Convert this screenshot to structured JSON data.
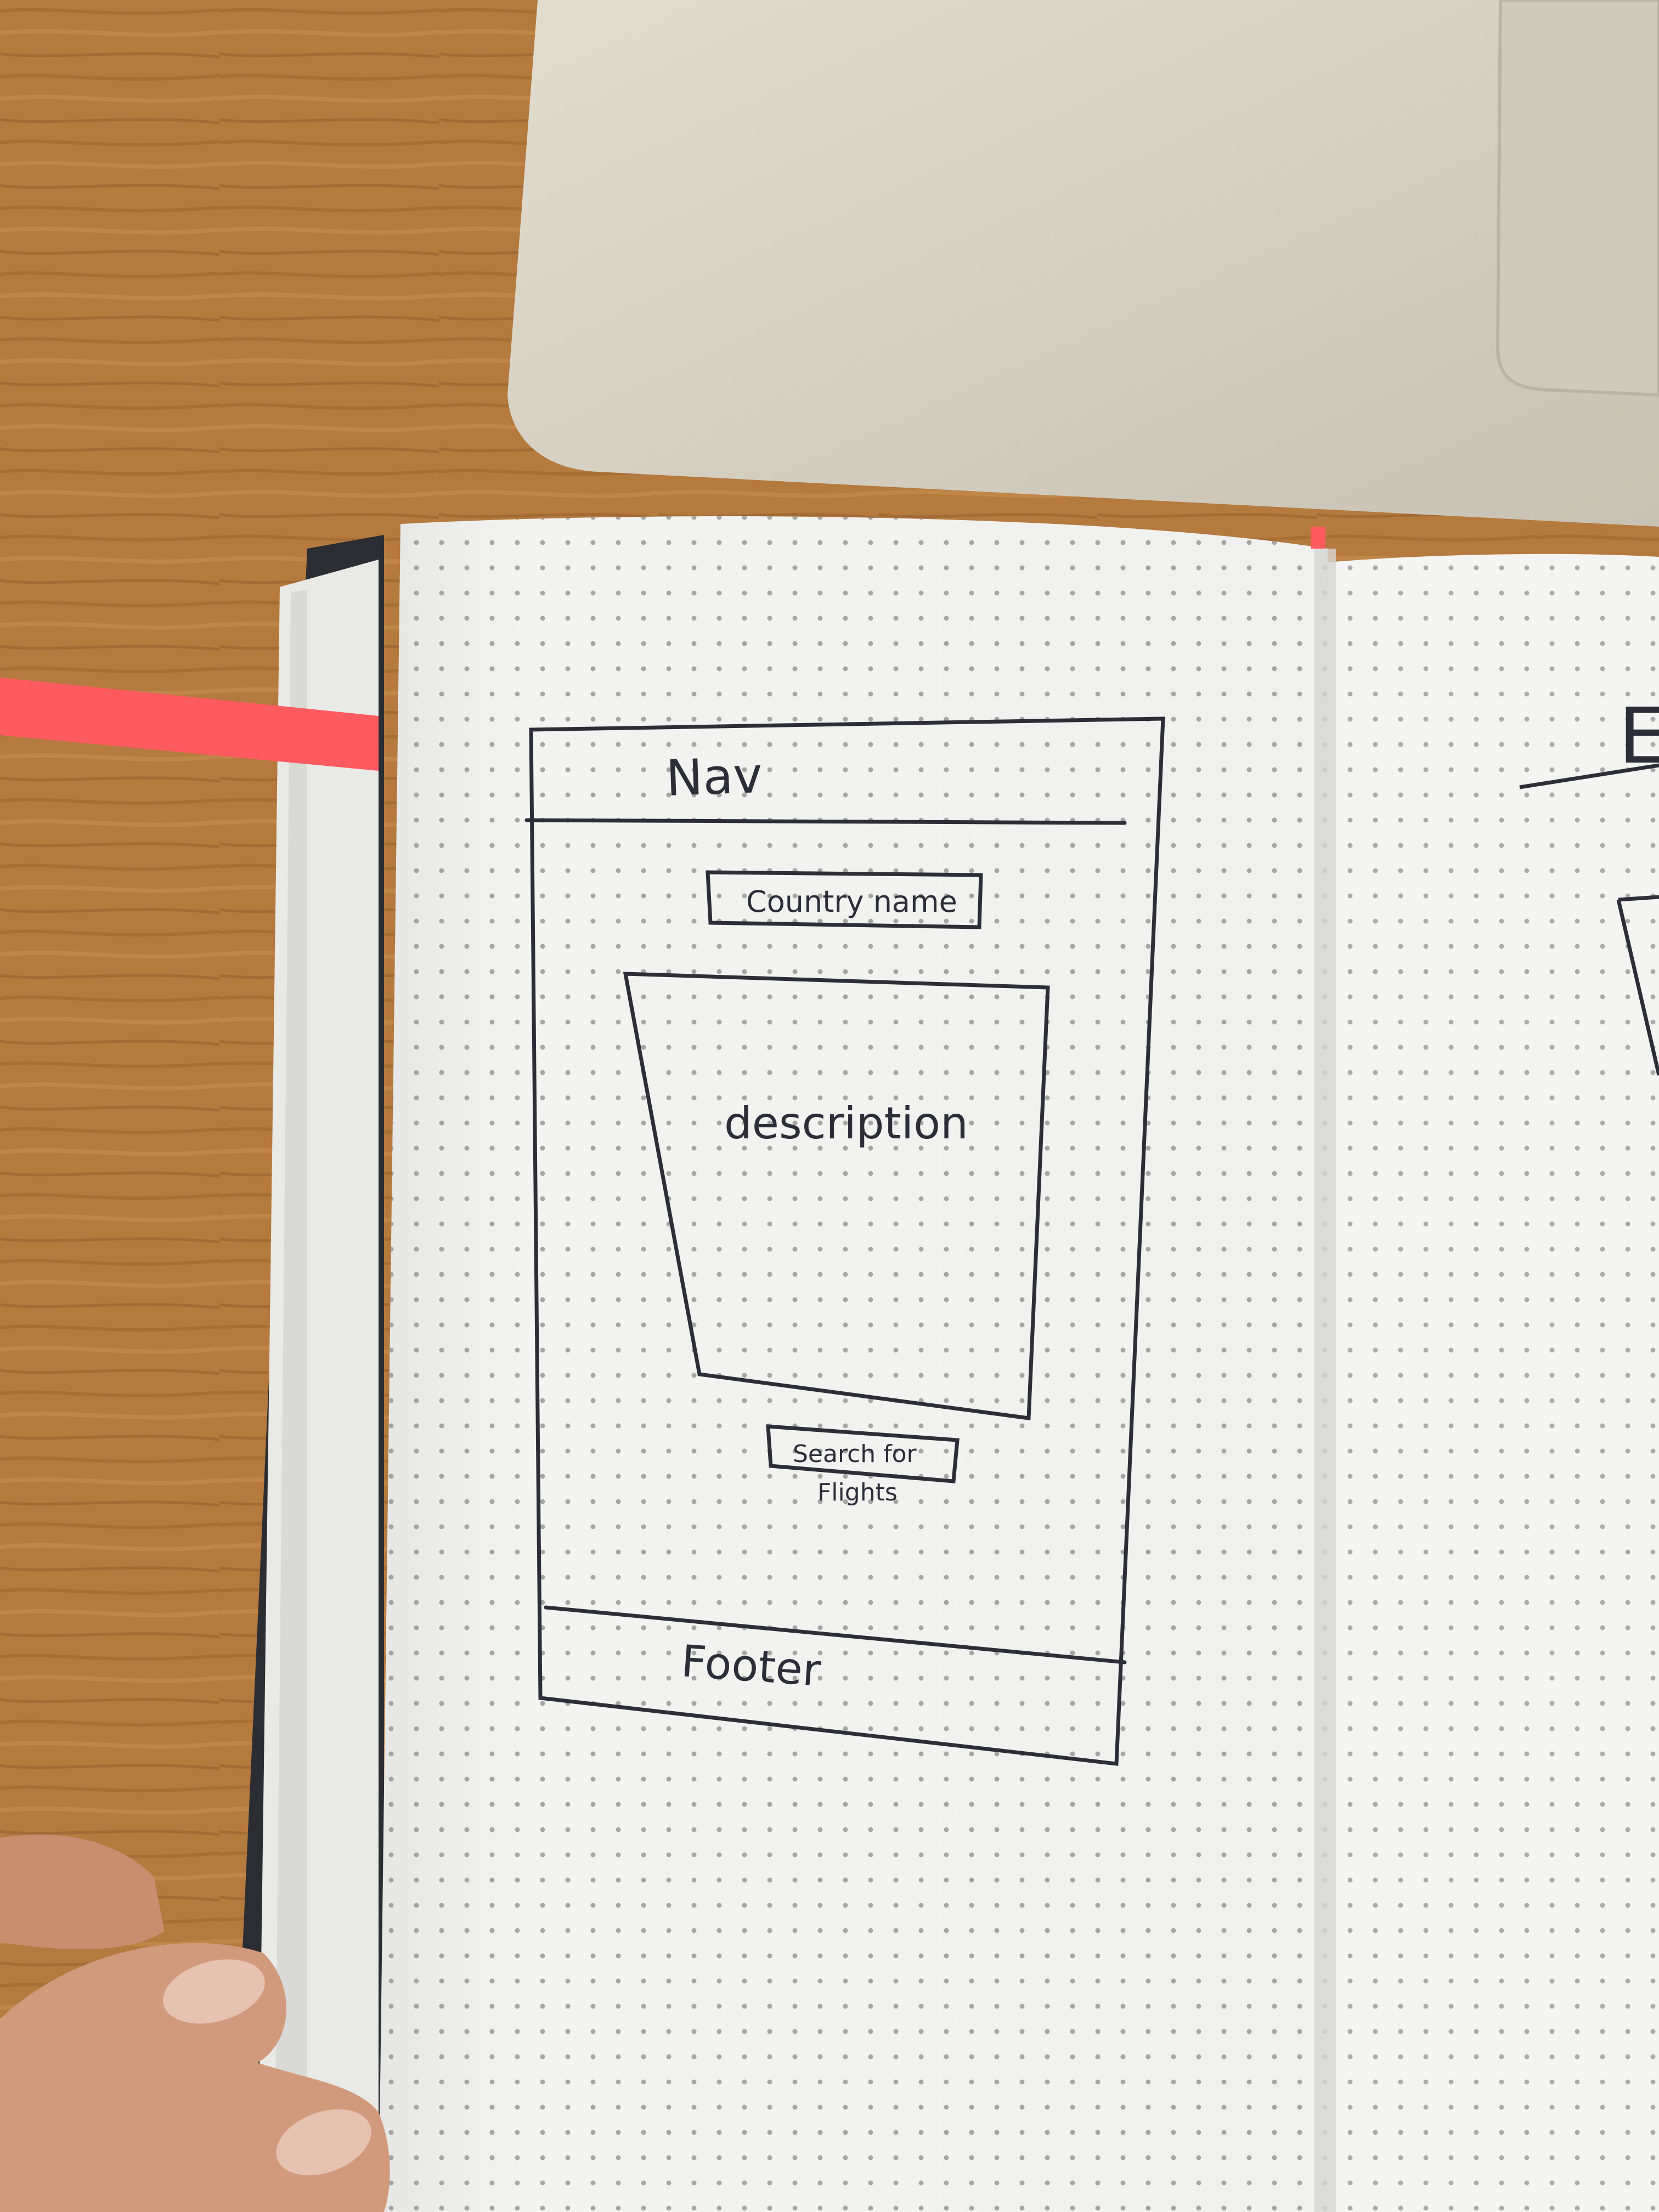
{
  "sketch": {
    "nav_label": "Nav",
    "country_name_label": "Country name",
    "description_label": "description",
    "search_button_line1": "Search for",
    "search_button_line2": "Flights",
    "footer_label": "Footer",
    "right_page_partial_letter": "E"
  },
  "colors": {
    "desk": "#b47a3e",
    "laptop": "#d8d3c5",
    "paper": "#f1f1ef",
    "ribbon": "#ff5a5f",
    "ink": "#2d2d3a",
    "dots": "#8c8c8c"
  }
}
